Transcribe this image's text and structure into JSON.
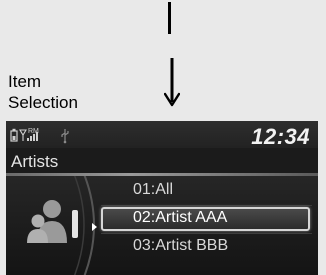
{
  "caption": {
    "line1": "Item",
    "line2": "Selection"
  },
  "statusbar": {
    "clock": "12:34",
    "rm_label": "RM",
    "icons": [
      "phone-battery-icon",
      "signal-strength-icon",
      "usb-icon"
    ]
  },
  "screen": {
    "title": "Artists"
  },
  "list": {
    "items": [
      {
        "label": "01:All"
      },
      {
        "label": "02:Artist AAA"
      },
      {
        "label": "03:Artist BBB"
      }
    ],
    "selected_index": 1
  },
  "icons": {
    "category": "artist-icon",
    "arrow": "down-arrow-icon"
  },
  "colors": {
    "screen_bg": "#1b1b1b",
    "highlight_border": "#d6d6d6",
    "page_bg": "#e9e9e9"
  }
}
